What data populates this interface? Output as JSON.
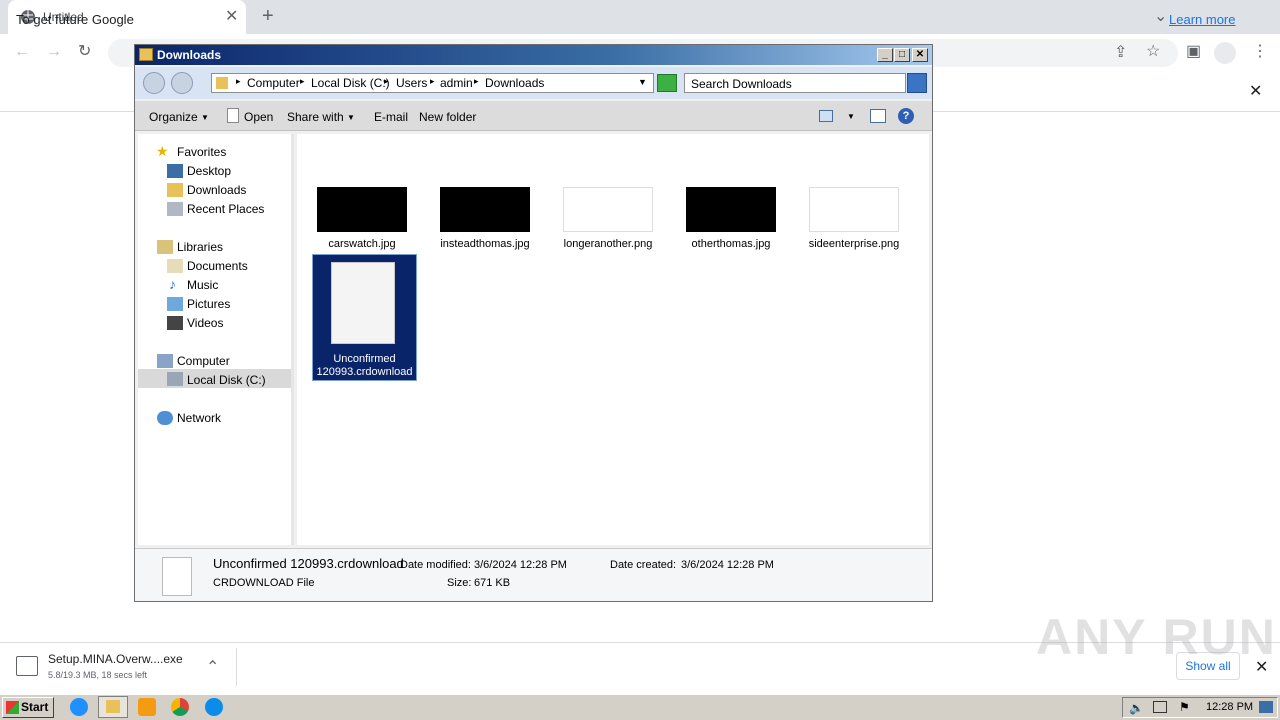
{
  "browser": {
    "tab_title": "Untitled",
    "infobar_text": "To get future Google",
    "learn_more": "Learn more",
    "download": {
      "name": "Setup.MINA.Overw....exe",
      "status": "5.8/19.3 MB, 18 secs left",
      "show_all": "Show all"
    }
  },
  "explorer": {
    "title": "Downloads",
    "breadcrumb": [
      "Computer",
      "Local Disk (C:)",
      "Users",
      "admin",
      "Downloads"
    ],
    "search_placeholder": "Search Downloads",
    "commands": [
      "Organize",
      "Open",
      "Share with",
      "E-mail",
      "New folder"
    ],
    "nav": {
      "favorites": "Favorites",
      "favorites_items": [
        "Desktop",
        "Downloads",
        "Recent Places"
      ],
      "libraries": "Libraries",
      "libraries_items": [
        "Documents",
        "Music",
        "Pictures",
        "Videos"
      ],
      "computer": "Computer",
      "computer_items": [
        "Local Disk (C:)"
      ],
      "network": "Network"
    },
    "files": [
      {
        "name": "carswatch.jpg",
        "thumb": "dark"
      },
      {
        "name": "insteadthomas.jpg",
        "thumb": "dark"
      },
      {
        "name": "longeranother.png",
        "thumb": "light"
      },
      {
        "name": "otherthomas.jpg",
        "thumb": "dark"
      },
      {
        "name": "sideenterprise.png",
        "thumb": "light"
      }
    ],
    "selected_file": {
      "line1": "Unconfirmed",
      "line2": "120993.crdownload"
    },
    "details": {
      "name": "Unconfirmed 120993.crdownload",
      "type": "CRDOWNLOAD File",
      "modified_label": "Date modified:",
      "modified": "3/6/2024 12:28 PM",
      "created_label": "Date created:",
      "created": "3/6/2024 12:28 PM",
      "size_label": "Size:",
      "size": "671 KB"
    }
  },
  "taskbar": {
    "start": "Start",
    "clock": "12:28 PM"
  },
  "watermark": "ANY RUN"
}
